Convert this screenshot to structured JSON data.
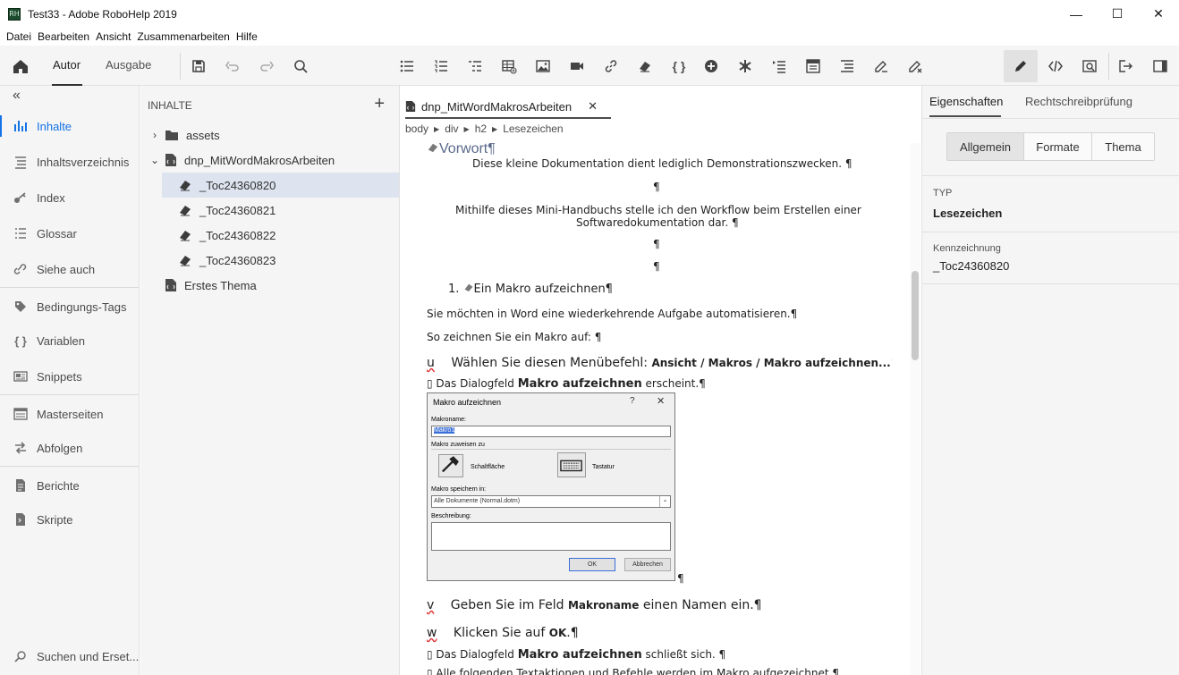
{
  "window": {
    "logo": "RH",
    "title": "Test33 - Adobe RoboHelp 2019",
    "controls": [
      "—",
      "☐",
      "✕"
    ]
  },
  "menu": [
    "Datei",
    "Bearbeiten",
    "Ansicht",
    "Zusammenarbeiten",
    "Hilfe"
  ],
  "toolbar": {
    "tabs": [
      "Autor",
      "Ausgabe"
    ],
    "active_tab": "Autor",
    "braces_label": "{ }"
  },
  "leftnav": {
    "collapse": "«",
    "items": [
      {
        "label": "Inhalte",
        "icon": "contents-icon"
      },
      {
        "label": "Inhaltsverzeichnis",
        "icon": "toc-icon"
      },
      {
        "label": "Index",
        "icon": "key-icon"
      },
      {
        "label": "Glossar",
        "icon": "glossary-icon"
      },
      {
        "label": "Siehe auch",
        "icon": "see-also-icon"
      },
      {
        "label": "Bedingungs-Tags",
        "icon": "tag-icon"
      },
      {
        "label": "Variablen",
        "icon": "braces-icon"
      },
      {
        "label": "Snippets",
        "icon": "snippet-icon"
      },
      {
        "label": "Masterseiten",
        "icon": "master-page-icon"
      },
      {
        "label": "Abfolgen",
        "icon": "browse-sequence-icon"
      },
      {
        "label": "Berichte",
        "icon": "report-icon"
      },
      {
        "label": "Skripte",
        "icon": "script-icon"
      },
      {
        "label": "Suchen und Erset...",
        "icon": "search-replace-icon"
      }
    ],
    "active": "Inhalte"
  },
  "contents": {
    "heading": "INHALTE",
    "add": "+",
    "tree": [
      {
        "label": "assets",
        "type": "folder",
        "chevron": "›"
      },
      {
        "label": "dnp_MitWordMakrosArbeiten",
        "type": "topic",
        "chevron": "⌄"
      },
      {
        "label": "_Toc24360820",
        "type": "bookmark"
      },
      {
        "label": "_Toc24360821",
        "type": "bookmark"
      },
      {
        "label": "_Toc24360822",
        "type": "bookmark"
      },
      {
        "label": "_Toc24360823",
        "type": "bookmark"
      },
      {
        "label": "Erstes Thema",
        "type": "topic"
      }
    ],
    "selected": "_Toc24360820"
  },
  "editor": {
    "tab_label": "dnp_MitWordMakrosArbeiten",
    "tab_close": "✕",
    "breadcrumb": [
      "body",
      "div",
      "h2",
      "Lesezeichen"
    ],
    "doc": {
      "heading": "Vorwort¶",
      "p1": "Diese kleine Dokumentation dient lediglich Demonstrationszwecken. ¶",
      "pil": "¶",
      "p2a": "Mithilfe dieses Mini-Handbuchs stelle ich den Workflow beim Erstellen einer",
      "p2b": "Softwaredokumentation dar. ¶",
      "h2_num": "1.",
      "h2": "Ein Makro aufzeichnen¶",
      "p3": "Sie möchten in Word eine wiederkehrende Aufgabe automatisieren.¶",
      "p4": "So zeichnen Sie ein Makro auf: ¶",
      "step1_marker": "u",
      "step1": "Wählen Sie diesen Menübefehl: ",
      "step1_bold": "Ansicht / Makros / Makro aufzeichnen...",
      "result1_pre": "Das Dialogfeld ",
      "result1_bold": "Makro aufzeichnen",
      "result1_post": " erscheint.¶",
      "step2_marker": "v",
      "step2_pre": "Geben Sie im Feld ",
      "step2_bold": "Makroname",
      "step2_post": "  einen Namen ein.¶",
      "step3_marker": "w",
      "step3_pre": "Klicken Sie auf ",
      "step3_bold": "OK",
      "step3_post": ".¶",
      "result2_pre": "Das Dialogfeld ",
      "result2_bold": "Makro aufzeichnen",
      "result2_post": " schließt sich. ¶",
      "result3": "Alle folgenden Textaktionen und Befehle werden im Makro aufgezeichnet.¶"
    },
    "dialog": {
      "title": "Makro aufzeichnen",
      "help": "?",
      "close": "✕",
      "makroname_label": "Makroname:",
      "makroname_value": "Makro1",
      "assign_label": "Makro zuweisen zu",
      "button_label": "Schaltfläche",
      "keyboard_label": "Tastatur",
      "save_label": "Makro speichern in:",
      "save_value": "Alle Dokumente (Normal.dotm)",
      "desc_label": "Beschreibung:",
      "ok": "OK",
      "cancel": "Abbrechen"
    }
  },
  "rpanel": {
    "tabs": [
      "Eigenschaften",
      "Rechtschreibprüfung"
    ],
    "segments": [
      "Allgemein",
      "Formate",
      "Thema"
    ],
    "active_segment": "Allgemein",
    "typ_label": "TYP",
    "typ_value": "Lesezeichen",
    "id_label": "Kennzeichnung",
    "id_value": "_Toc24360820"
  },
  "colors": {
    "accent": "#1473e6",
    "selection": "#dde4ef",
    "panel_bg": "#f5f5f5",
    "doc_heading": "#5a6a8a"
  }
}
